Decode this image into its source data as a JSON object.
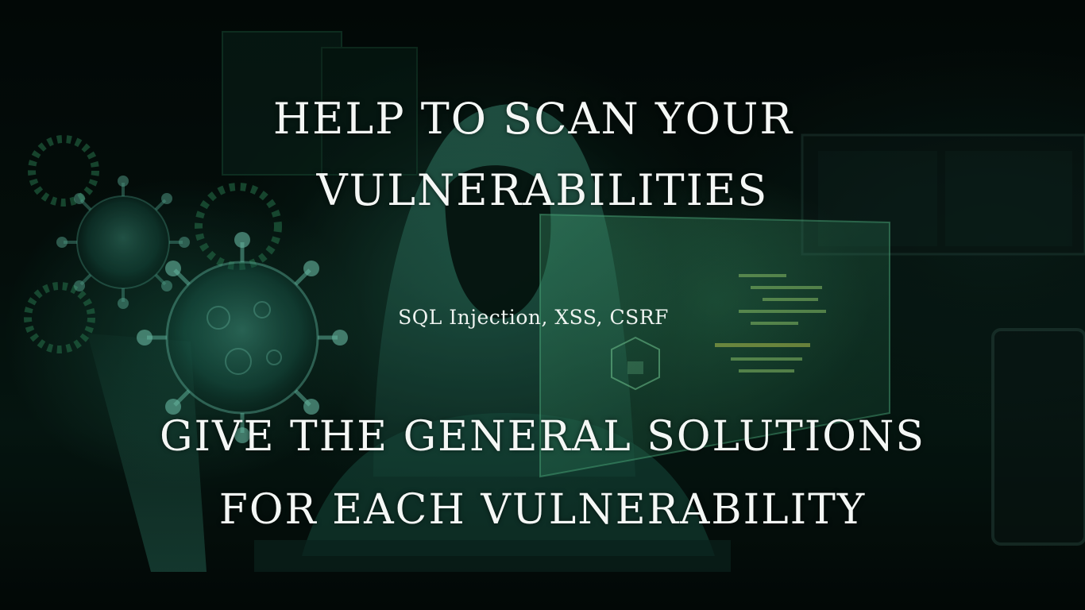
{
  "slide": {
    "heading_line1": "HELP TO SCAN YOUR",
    "heading_line2": "VULNERABILITIES",
    "subtitle": "SQL Injection, XSS, CSRF",
    "heading2_line1": "GIVE THE GENERAL SOLUTIONS",
    "heading2_line2": "FOR EACH VULNERABILITY"
  },
  "colors": {
    "background": "#020806",
    "accent_glow": "#2e8f6e",
    "text": "#f4f7f5"
  },
  "icons": {
    "hacker": "hooded-hacker-illustration",
    "virus": "virus-icon",
    "screen": "code-screen-illustration",
    "lock": "padlock-icon"
  }
}
